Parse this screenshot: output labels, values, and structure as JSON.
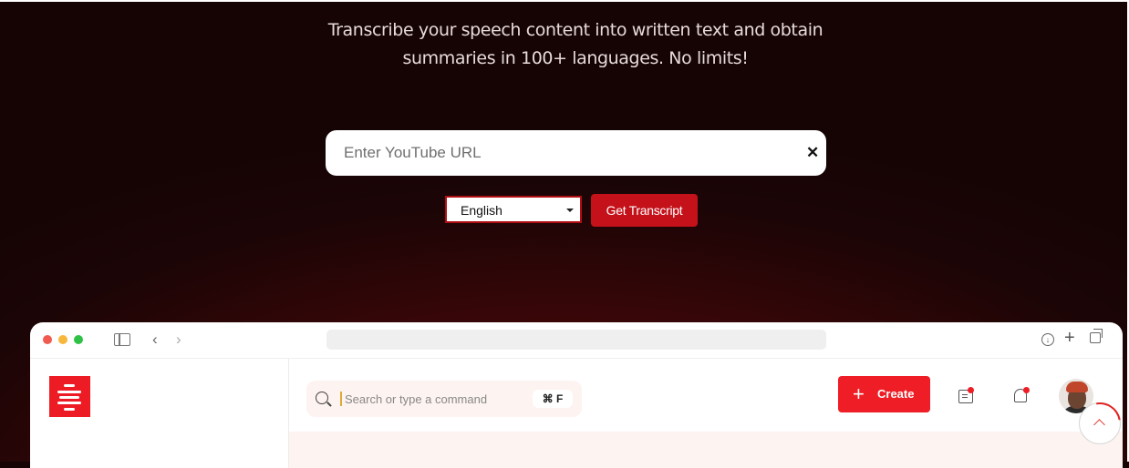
{
  "hero": {
    "subtitle_line1": "Transcribe your speech content into written text and obtain",
    "subtitle_line2": "summaries in 100+ languages. No limits!"
  },
  "form": {
    "url_placeholder": "Enter YouTube URL",
    "url_value": "",
    "clear_symbol": "✕",
    "language_selected": "English",
    "submit_label": "Get Transcript"
  },
  "preview": {
    "search_placeholder": "Search or type a command",
    "shortcut": "⌘ F",
    "create_label": "Create",
    "create_symbol": "+"
  },
  "icons": {
    "browser": [
      "sidebar-toggle-icon",
      "back-icon",
      "forward-icon",
      "download-icon",
      "new-tab-icon",
      "tabs-icon"
    ],
    "app": [
      "logo-icon",
      "search-icon",
      "message-icon",
      "bell-icon",
      "avatar"
    ],
    "page": [
      "scroll-to-top-icon"
    ]
  },
  "colors": {
    "accent": "#c4111a",
    "create_button": "#ee1d26",
    "background_dark": "#1c0506"
  }
}
